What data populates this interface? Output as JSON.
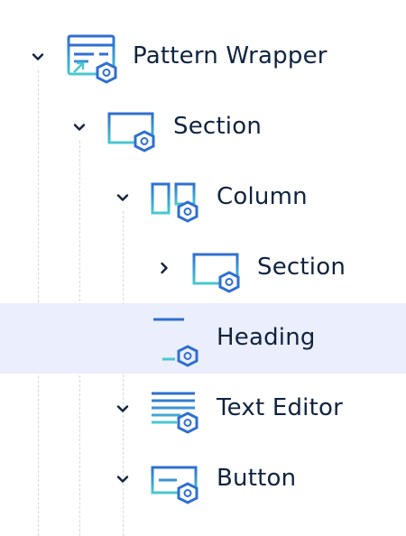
{
  "colors": {
    "accent_blue": "#2f6fd0",
    "accent_teal": "#4ac8cf",
    "text": "#0f2340",
    "selected_bg": "#ebeefc",
    "guide": "#d6d8de"
  },
  "tree": {
    "items": [
      {
        "label": "Pattern Wrapper",
        "icon": "pattern-wrapper-icon",
        "toggle": "expanded"
      },
      {
        "label": "Section",
        "icon": "section-icon",
        "toggle": "expanded"
      },
      {
        "label": "Column",
        "icon": "column-icon",
        "toggle": "expanded"
      },
      {
        "label": "Section",
        "icon": "section-icon",
        "toggle": "collapsed"
      },
      {
        "label": "Heading",
        "icon": "heading-icon",
        "toggle": "none",
        "selected": true
      },
      {
        "label": "Text Editor",
        "icon": "text-editor-icon",
        "toggle": "expanded"
      },
      {
        "label": "Button",
        "icon": "button-icon",
        "toggle": "expanded"
      }
    ]
  }
}
